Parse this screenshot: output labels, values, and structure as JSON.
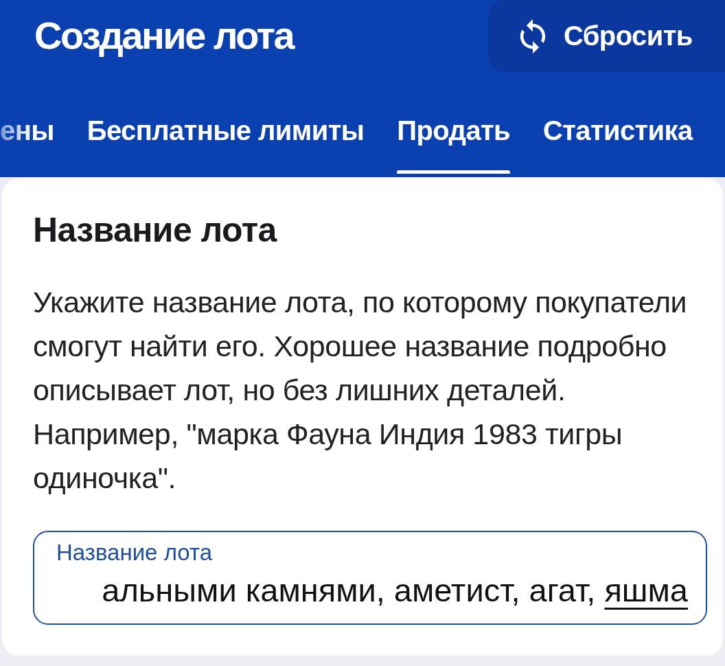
{
  "header": {
    "title": "Создание лота",
    "reset_button": {
      "label": "Сбросить"
    }
  },
  "tabs": [
    {
      "label": "ены",
      "selected": false
    },
    {
      "label": "Бесплатные лимиты",
      "selected": false
    },
    {
      "label": "Продать",
      "selected": true
    },
    {
      "label": "Статистика",
      "selected": false
    }
  ],
  "section": {
    "title": "Название лота",
    "description": "Укажите название лота, по которому покупатели смогут найти его. Хорошее название подробно описывает лот, но без лишних деталей. Например, \"марка Фауна Индия 1983 тигры одиночка\".",
    "field": {
      "label": "Название лота",
      "value": "альными камнями, аметист, агат, яшма",
      "focused": true,
      "underline_last_word": true
    }
  }
}
